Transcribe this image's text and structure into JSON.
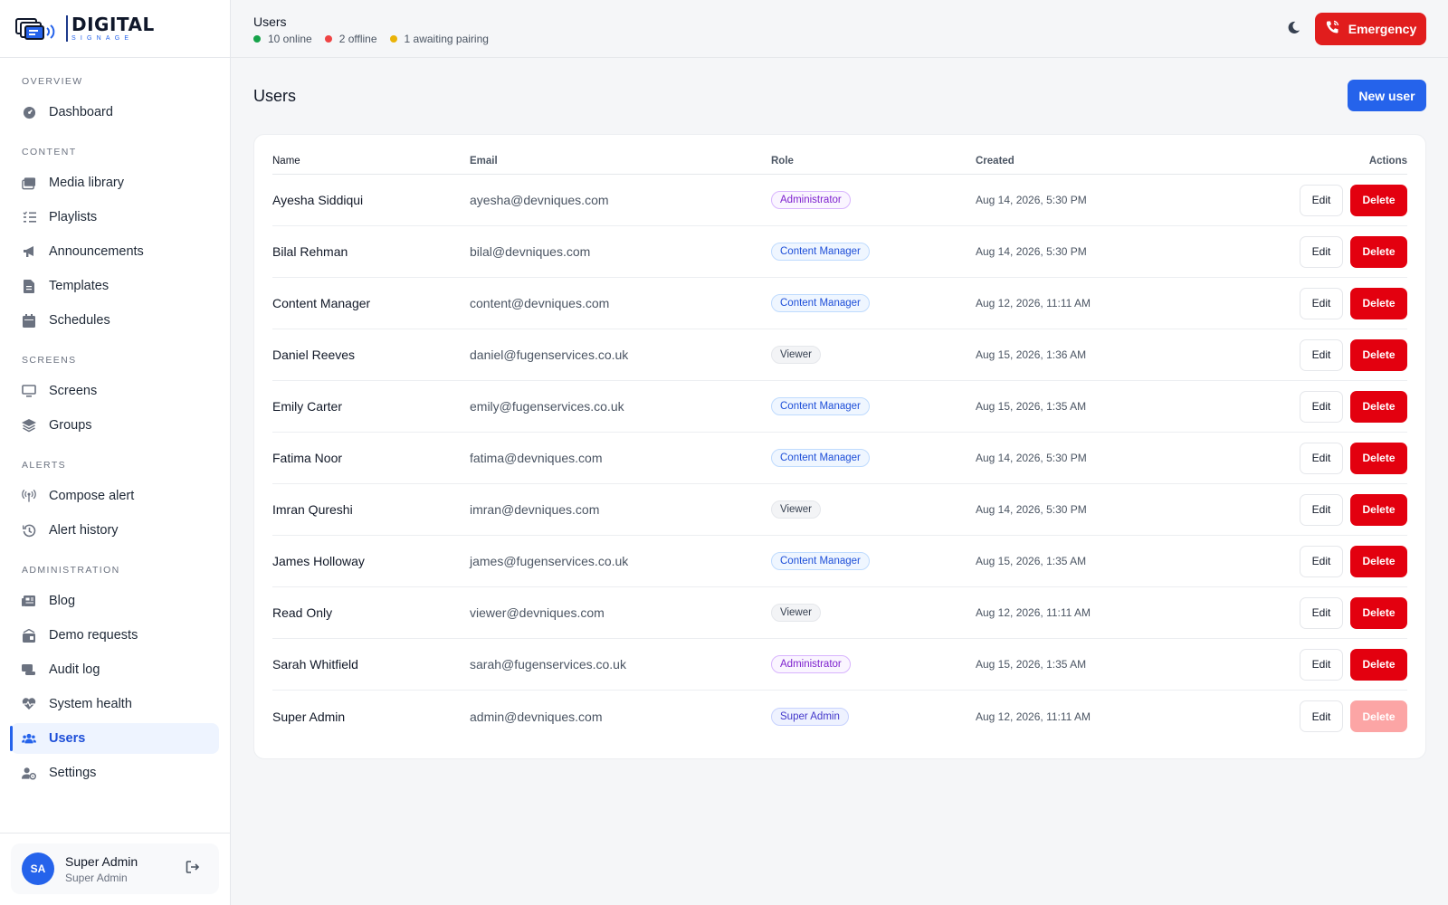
{
  "brand": {
    "name": "DIGITAL",
    "tagline": "SIGNAGE"
  },
  "sidebar": {
    "sections": [
      {
        "label": "OVERVIEW",
        "items": [
          {
            "label": "Dashboard",
            "icon": "dashboard-icon"
          }
        ]
      },
      {
        "label": "CONTENT",
        "items": [
          {
            "label": "Media library",
            "icon": "media-library-icon"
          },
          {
            "label": "Playlists",
            "icon": "playlist-icon"
          },
          {
            "label": "Announcements",
            "icon": "megaphone-icon"
          },
          {
            "label": "Templates",
            "icon": "document-icon"
          },
          {
            "label": "Schedules",
            "icon": "calendar-icon"
          }
        ]
      },
      {
        "label": "SCREENS",
        "items": [
          {
            "label": "Screens",
            "icon": "monitor-icon"
          },
          {
            "label": "Groups",
            "icon": "layers-icon"
          }
        ]
      },
      {
        "label": "ALERTS",
        "items": [
          {
            "label": "Compose alert",
            "icon": "broadcast-icon"
          },
          {
            "label": "Alert history",
            "icon": "history-icon"
          }
        ]
      },
      {
        "label": "ADMINISTRATION",
        "items": [
          {
            "label": "Blog",
            "icon": "newspaper-icon"
          },
          {
            "label": "Demo requests",
            "icon": "briefcase-icon"
          },
          {
            "label": "Audit log",
            "icon": "scroll-icon"
          },
          {
            "label": "System health",
            "icon": "heartbeat-icon"
          },
          {
            "label": "Users",
            "icon": "users-icon",
            "active": true
          },
          {
            "label": "Settings",
            "icon": "user-gear-icon"
          }
        ]
      }
    ],
    "user": {
      "initials": "SA",
      "name": "Super Admin",
      "role": "Super Admin"
    }
  },
  "topbar": {
    "title": "Users",
    "status": [
      {
        "label": "10 online",
        "color": "#16a34a"
      },
      {
        "label": "2 offline",
        "color": "#ef4444"
      },
      {
        "label": "1 awaiting pairing",
        "color": "#eab308"
      }
    ],
    "emergency_label": "Emergency"
  },
  "main": {
    "title": "Users",
    "new_user_label": "New user",
    "table": {
      "headers": {
        "name": "Name",
        "email": "Email",
        "role": "Role",
        "created": "Created",
        "actions": "Actions"
      },
      "edit_label": "Edit",
      "delete_label": "Delete",
      "rows": [
        {
          "name": "Ayesha Siddiqui",
          "email": "ayesha@devniques.com",
          "role": "Administrator",
          "created": "Aug 14, 2026, 5:30 PM"
        },
        {
          "name": "Bilal Rehman",
          "email": "bilal@devniques.com",
          "role": "Content Manager",
          "created": "Aug 14, 2026, 5:30 PM"
        },
        {
          "name": "Content Manager",
          "email": "content@devniques.com",
          "role": "Content Manager",
          "created": "Aug 12, 2026, 11:11 AM"
        },
        {
          "name": "Daniel Reeves",
          "email": "daniel@fugenservices.co.uk",
          "role": "Viewer",
          "created": "Aug 15, 2026, 1:36 AM"
        },
        {
          "name": "Emily Carter",
          "email": "emily@fugenservices.co.uk",
          "role": "Content Manager",
          "created": "Aug 15, 2026, 1:35 AM"
        },
        {
          "name": "Fatima Noor",
          "email": "fatima@devniques.com",
          "role": "Content Manager",
          "created": "Aug 14, 2026, 5:30 PM"
        },
        {
          "name": "Imran Qureshi",
          "email": "imran@devniques.com",
          "role": "Viewer",
          "created": "Aug 14, 2026, 5:30 PM"
        },
        {
          "name": "James Holloway",
          "email": "james@fugenservices.co.uk",
          "role": "Content Manager",
          "created": "Aug 15, 2026, 1:35 AM"
        },
        {
          "name": "Read Only",
          "email": "viewer@devniques.com",
          "role": "Viewer",
          "created": "Aug 12, 2026, 11:11 AM"
        },
        {
          "name": "Sarah Whitfield",
          "email": "sarah@fugenservices.co.uk",
          "role": "Administrator",
          "created": "Aug 15, 2026, 1:35 AM"
        },
        {
          "name": "Super Admin",
          "email": "admin@devniques.com",
          "role": "Super Admin",
          "created": "Aug 12, 2026, 11:11 AM",
          "delete_disabled": true
        }
      ]
    }
  },
  "colors": {
    "accent": "#2563eb",
    "danger": "#e3000f",
    "danger_disabled": "#fca5a5"
  }
}
